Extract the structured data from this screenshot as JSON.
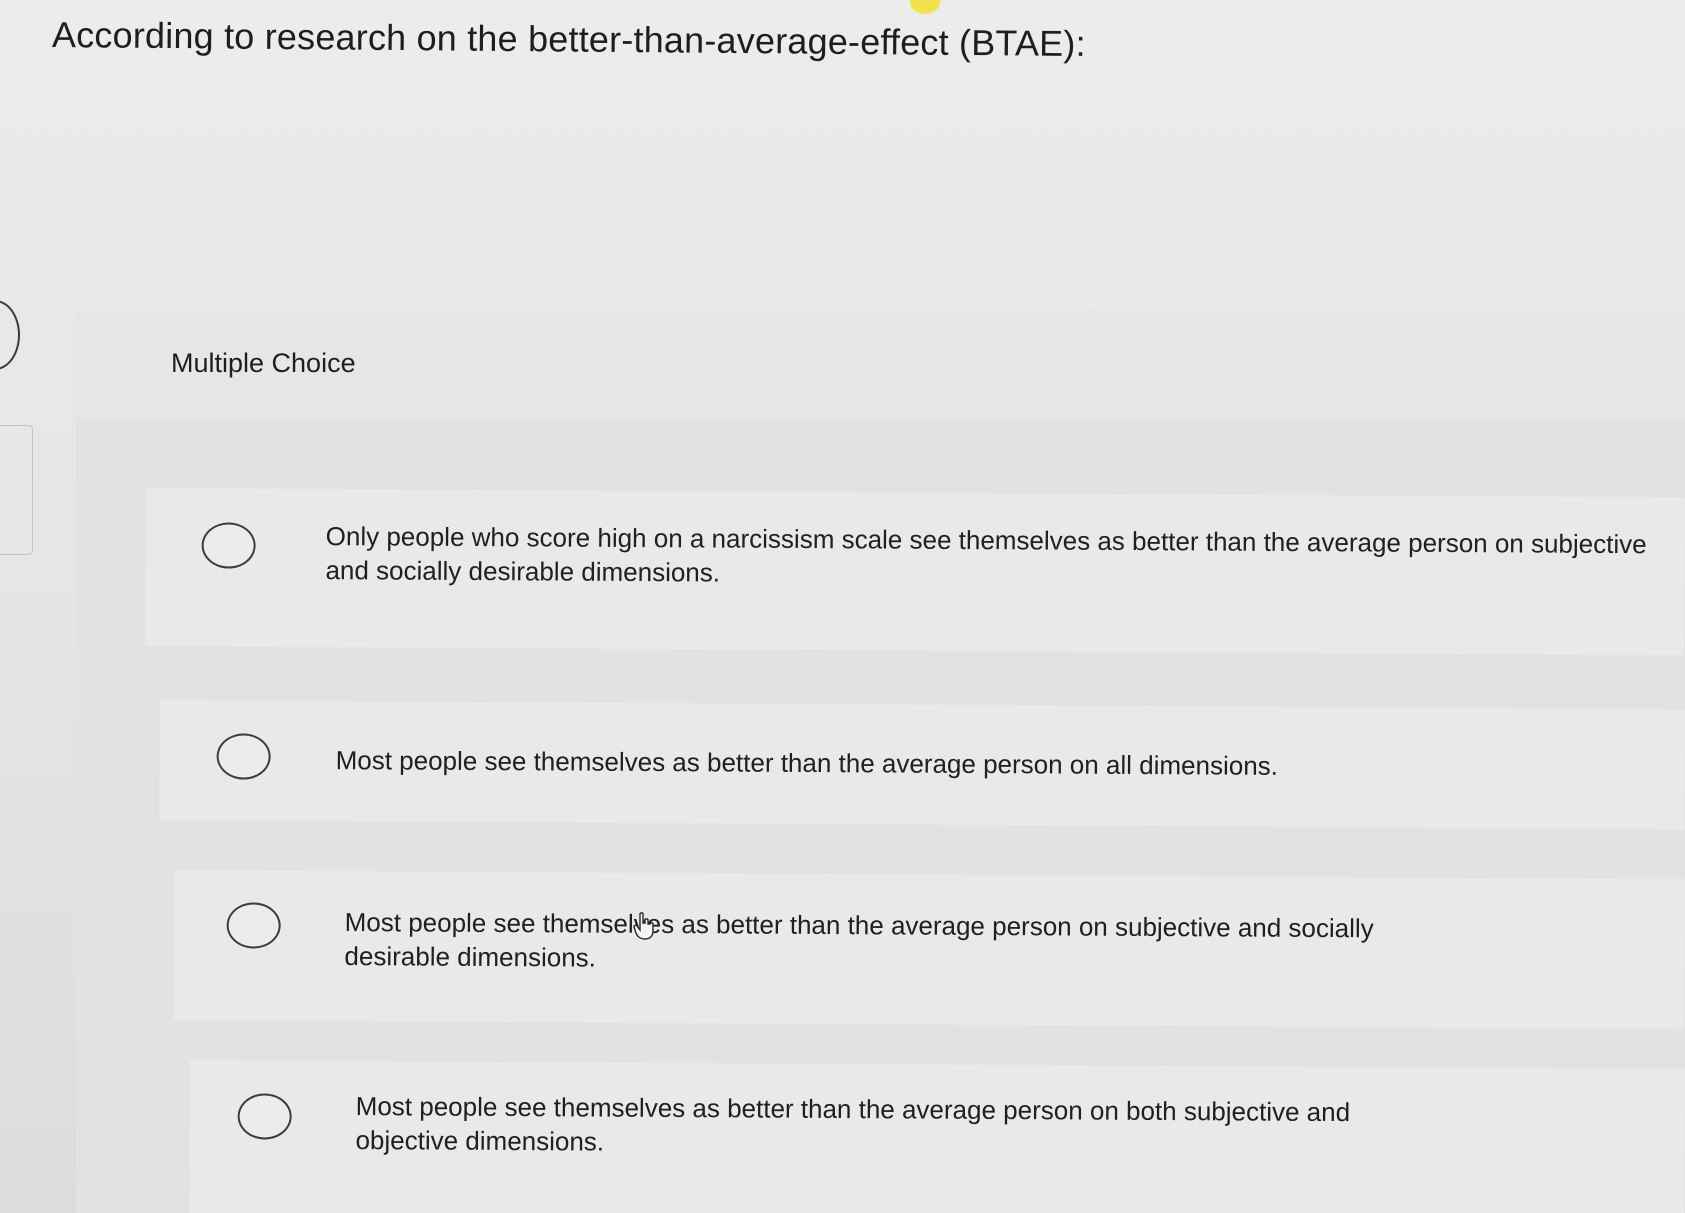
{
  "question": {
    "text": "According to research on the better-than-average-effect (BTAE):"
  },
  "section": {
    "label": "Multiple Choice"
  },
  "choices": [
    {
      "text": "Only people who score high on a narcissism scale see themselves as better than the average person on subjective and socially desirable dimensions."
    },
    {
      "text": "Most people see themselves as better than the average person on all dimensions."
    },
    {
      "text": "Most people see themselves as better than the average person on subjective and socially desirable dimensions."
    },
    {
      "text": "Most people see themselves as better than the average person on both subjective and objective dimensions."
    }
  ],
  "icons": {
    "radio": "radio-circle-icon",
    "cursor": "hand-pointer-icon"
  },
  "colors": {
    "background": "#e6e6e4",
    "panel": "#e2e2e0",
    "choice": "#e9e9e7",
    "text": "#1e1e1e"
  }
}
